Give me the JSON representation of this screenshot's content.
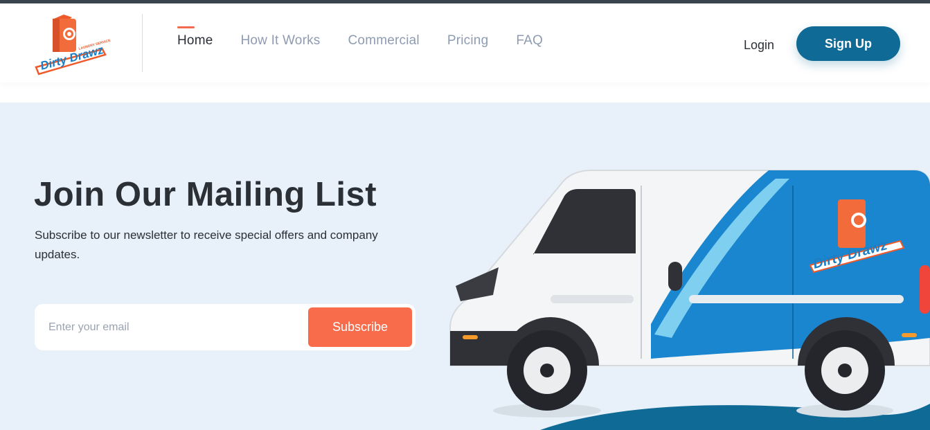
{
  "brand": {
    "name": "Dirty Drawz",
    "tagline": "LAUNDRY SERVICE"
  },
  "nav": {
    "items": [
      {
        "label": "Home",
        "active": true
      },
      {
        "label": "How It Works",
        "active": false
      },
      {
        "label": "Commercial",
        "active": false
      },
      {
        "label": "Pricing",
        "active": false
      },
      {
        "label": "FAQ",
        "active": false
      }
    ],
    "login_label": "Login",
    "signup_label": "Sign Up"
  },
  "hero": {
    "title": "Join Our Mailing List",
    "subtitle": "Subscribe to our newsletter to receive special offers and company updates.",
    "email_placeholder": "Enter your email",
    "subscribe_label": "Subscribe"
  },
  "colors": {
    "accent": "#f96c4b",
    "primary": "#0f6a96",
    "hero_bg": "#e8f1f9",
    "text": "#2b2f36",
    "muted": "#8e9bb0"
  },
  "icons": {
    "logo": "laundry-bag-logo",
    "illustration": "delivery-van-illustration"
  }
}
